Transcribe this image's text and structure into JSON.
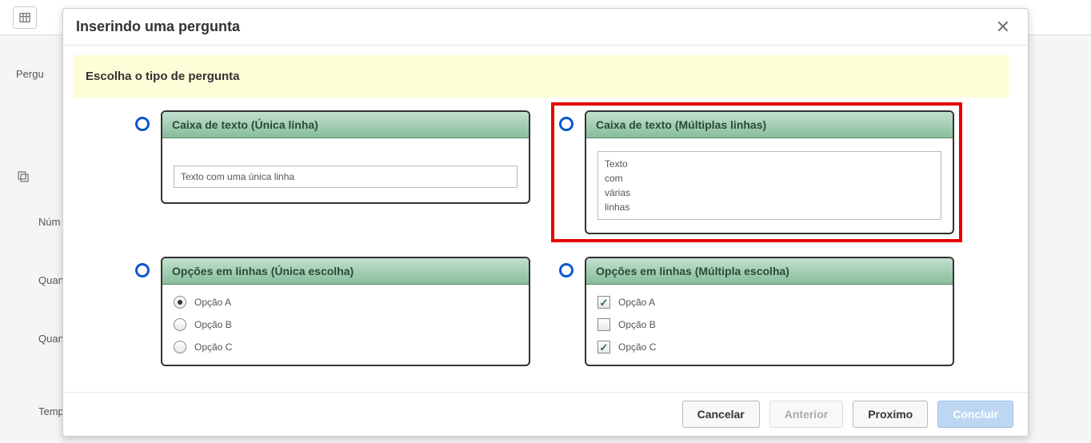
{
  "back": {
    "labels": [
      "Pergu",
      "Núm",
      "Quan",
      "Quan",
      "Temp"
    ]
  },
  "modal": {
    "title": "Inserindo uma pergunta",
    "banner": "Escolha o tipo de pergunta",
    "options": {
      "singleLine": {
        "header": "Caixa de texto (Única linha)",
        "sample": "Texto com uma única linha"
      },
      "multiLine": {
        "header": "Caixa de texto (Múltiplas linhas)",
        "sample": "Texto\ncom\nvárias\nlinhas"
      },
      "singleChoice": {
        "header": "Opções em linhas (Única escolha)",
        "items": [
          "Opção A",
          "Opção B",
          "Opção C"
        ],
        "checked": [
          true,
          false,
          false
        ]
      },
      "multiChoice": {
        "header": "Opções em linhas (Múltipla escolha)",
        "items": [
          "Opção A",
          "Opção B",
          "Opção C"
        ],
        "checked": [
          true,
          false,
          true
        ]
      }
    },
    "footer": {
      "cancel": "Cancelar",
      "prev": "Anterior",
      "next": "Proximo",
      "finish": "Concluir"
    }
  }
}
